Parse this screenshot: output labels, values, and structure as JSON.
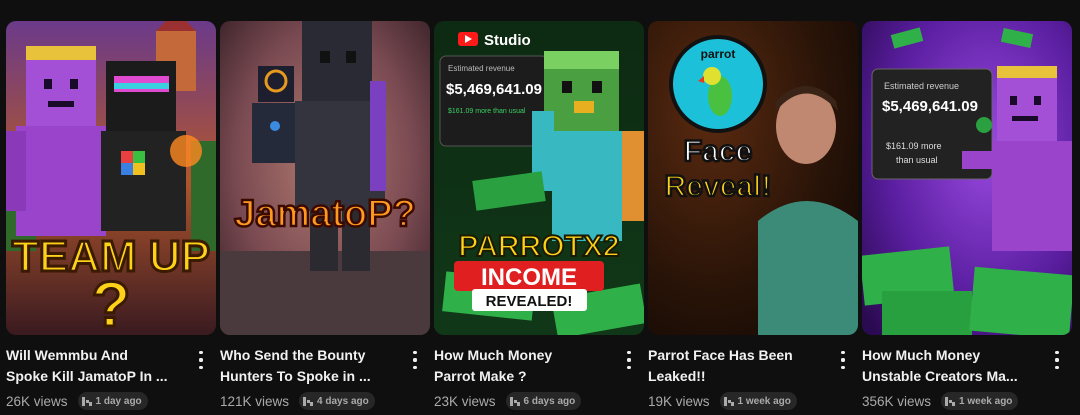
{
  "videos": [
    {
      "title": "Will Wemmbu And\nSpoke Kill JamatoP In ...",
      "views": "26K views",
      "age": "1 day ago",
      "thumb_text": [
        "TEAM UP",
        "?"
      ]
    },
    {
      "title": "Who Send the Bounty\nHunters To Spoke in ...",
      "views": "121K views",
      "age": "4 days ago",
      "thumb_text": [
        "JamatoP?"
      ]
    },
    {
      "title": "How Much Money\nParrot Make ?",
      "views": "23K views",
      "age": "6 days ago",
      "thumb_text": [
        "Studio",
        "Estimated revenue",
        "$5,469,641.09",
        "$161.09 more than usual",
        "PARROTX2",
        "INCOME",
        "REVEALED!"
      ]
    },
    {
      "title": "Parrot Face Has Been\nLeaked!!",
      "views": "19K views",
      "age": "1 week ago",
      "thumb_text": [
        "parrot",
        "Face",
        "Reveal!"
      ]
    },
    {
      "title": "How Much Money\nUnstable Creators Ma...",
      "views": "356K views",
      "age": "1 week ago",
      "thumb_text": [
        "Estimated revenue",
        "$5,469,641.09",
        "$161.09 more",
        "than usual"
      ]
    }
  ],
  "colors": {
    "background": "#0f0f0f",
    "title": "#f1f1f1",
    "meta": "#aaaaaa",
    "badge_bg": "#272727"
  },
  "icons": {
    "more": "more-vert-icon",
    "badge": "trending-icon"
  }
}
